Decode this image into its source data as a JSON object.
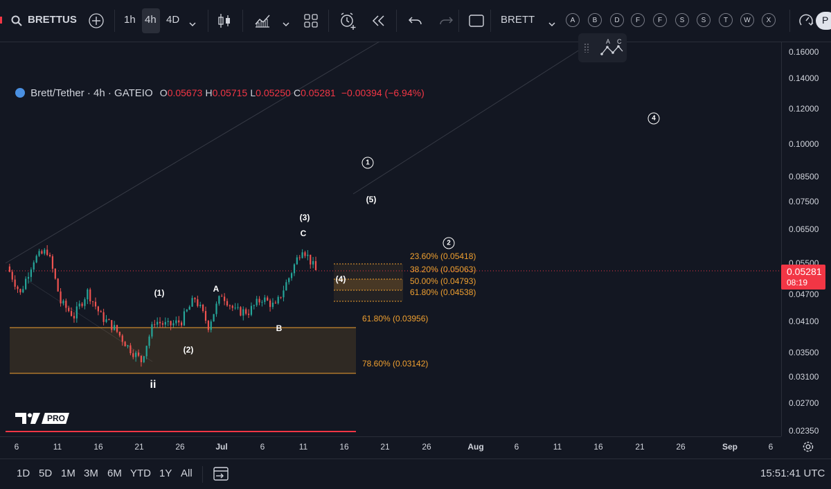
{
  "toolbar": {
    "symbol": "BRETTUS",
    "timeframes": [
      "1h",
      "4h",
      "4D"
    ],
    "active_timeframe": "4h",
    "chart_name": "BRETT",
    "drawing_letters": [
      "A",
      "B",
      "D",
      "F",
      "F",
      "S",
      "S",
      "T",
      "W",
      "X"
    ],
    "profile_initial": "P"
  },
  "legend": {
    "title": "Brett/Tether · 4h · GATEIO",
    "open_label": "O",
    "open": "0.05673",
    "high_label": "H",
    "high": "0.05715",
    "low_label": "L",
    "low": "0.05250",
    "close_label": "C",
    "close": "0.05281",
    "change": "−0.00394 (−6.94%)"
  },
  "current_price": {
    "price": "0.05281",
    "countdown": "08:19"
  },
  "price_axis": [
    "0.16000",
    "0.14000",
    "0.12000",
    "0.10000",
    "0.08500",
    "0.07500",
    "0.06500",
    "0.05500",
    "0.04700",
    "0.04100",
    "0.03500",
    "0.03100",
    "0.02700",
    "0.02350"
  ],
  "time_axis": [
    "6",
    "11",
    "16",
    "21",
    "26",
    "Jul",
    "6",
    "11",
    "16",
    "21",
    "26",
    "Aug",
    "6",
    "11",
    "16",
    "21",
    "26",
    "Sep",
    "6"
  ],
  "range_buttons": [
    "1D",
    "5D",
    "1M",
    "3M",
    "6M",
    "YTD",
    "1Y",
    "All"
  ],
  "clock": "15:51:41 UTC",
  "watermark": "PRO",
  "waves": {
    "ii": "ii",
    "w1": "(1)",
    "w2": "(2)",
    "w3": "(3)",
    "w4": "(4)",
    "w5": "(5)",
    "a": "A",
    "b": "B",
    "c": "C",
    "c1": "1",
    "c2": "2",
    "c4": "4",
    "mini_a": "A",
    "mini_c": "C"
  },
  "fib_levels": {
    "f236": "23.60% (0.05418)",
    "f382": "38.20% (0.05063)",
    "f500": "50.00% (0.04793)",
    "f618": "61.80% (0.04538)",
    "g618": "61.80% (0.03956)",
    "g786": "78.60% (0.03142)"
  },
  "colors": {
    "background": "#131722",
    "up_candle": "#26a69a",
    "down_candle": "#ef5350",
    "fib": "#f0a030",
    "current_price": "#f23645"
  },
  "chart_data": {
    "type": "candlestick",
    "interval": "4h",
    "symbol": "Brett/Tether",
    "x": [
      "6",
      "11",
      "16",
      "21",
      "26",
      "Jul",
      "6",
      "11"
    ],
    "close_path": [
      0.054,
      0.047,
      0.056,
      0.0585,
      0.045,
      0.042,
      0.0475,
      0.042,
      0.0395,
      0.036,
      0.0335,
      0.041,
      0.04,
      0.041,
      0.046,
      0.04,
      0.047,
      0.043,
      0.043,
      0.046,
      0.044,
      0.051,
      0.0595,
      0.0528
    ],
    "ylim": [
      0.0235,
      0.16
    ]
  }
}
